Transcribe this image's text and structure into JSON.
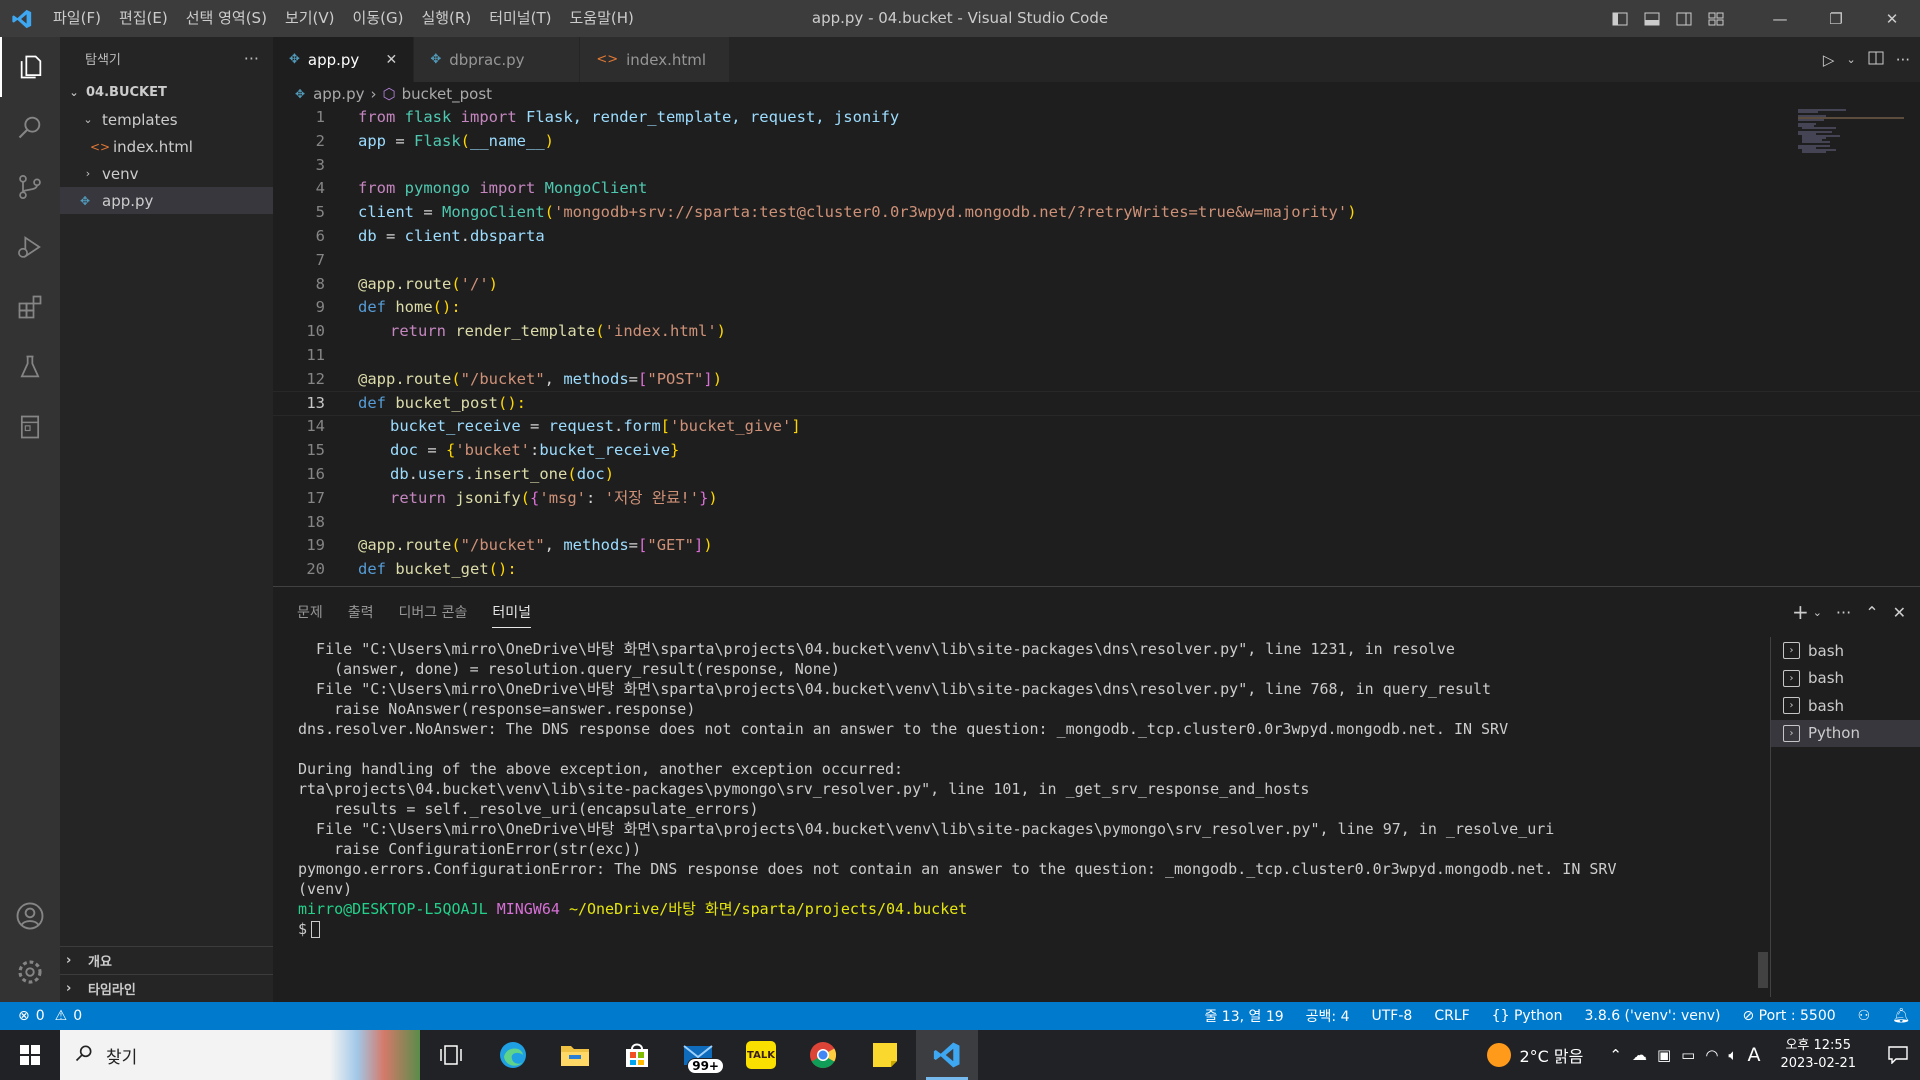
{
  "titlebar": {
    "menu": [
      "파일(F)",
      "편집(E)",
      "선택 영역(S)",
      "보기(V)",
      "이동(G)",
      "실행(R)",
      "터미널(T)",
      "도움말(H)"
    ],
    "title": "app.py - 04.bucket - Visual Studio Code",
    "window_controls": [
      "minimize-icon",
      "restore-icon",
      "close-icon"
    ]
  },
  "sidebar": {
    "header": "탐색기",
    "more": "···",
    "root": "04.BUCKET",
    "tree": [
      {
        "label": "templates",
        "type": "folder-open"
      },
      {
        "label": "index.html",
        "type": "html-file"
      },
      {
        "label": "venv",
        "type": "folder-closed"
      },
      {
        "label": "app.py",
        "type": "python-file",
        "selected": true
      }
    ],
    "outline": "개요",
    "timeline": "타임라인"
  },
  "tabs": [
    {
      "label": "app.py",
      "active": true,
      "close": "✕"
    },
    {
      "label": "dbprac.py",
      "active": false
    },
    {
      "label": "index.html",
      "active": false
    }
  ],
  "breadcrumb": {
    "file": "app.py",
    "separator": "›",
    "symbol": "bucket_post"
  },
  "editor": {
    "current_line": 13,
    "line_numbers": [
      "1",
      "2",
      "3",
      "4",
      "5",
      "6",
      "7",
      "8",
      "9",
      "10",
      "11",
      "12",
      "13",
      "14",
      "15",
      "16",
      "17",
      "18",
      "19",
      "20"
    ],
    "lines": {
      "l1": [
        "from",
        " flask ",
        "import",
        " Flask, render_template, request, jsonify"
      ],
      "l2": [
        "app",
        " = ",
        "Flask",
        "(",
        "__name__",
        ")"
      ],
      "l4": [
        "from",
        " pymongo ",
        "import",
        " MongoClient"
      ],
      "l5": [
        "client",
        " = ",
        "MongoClient",
        "(",
        "'mongodb+srv://sparta:test@cluster0.0r3wpyd.mongodb.net/?retryWrites=true&w=majority'",
        ")"
      ],
      "l6": [
        "db",
        " = ",
        "client",
        ".",
        "dbsparta"
      ],
      "l8": [
        "@app.route",
        "(",
        "'/'",
        ")"
      ],
      "l9": [
        "def",
        " ",
        "home",
        "():"
      ],
      "l10": [
        "return",
        " ",
        "render_template",
        "(",
        "'index.html'",
        ")"
      ],
      "l12": [
        "@app.route",
        "(",
        "\"/bucket\"",
        ", ",
        "methods",
        "=",
        "[",
        "\"POST\"",
        "]",
        ")"
      ],
      "l13": [
        "def",
        " ",
        "bucket_post",
        "():"
      ],
      "l14": [
        "bucket_receive",
        " = ",
        "request",
        ".",
        "form",
        "[",
        "'bucket_give'",
        "]"
      ],
      "l15": [
        "doc",
        " = ",
        "{",
        "'bucket'",
        ":",
        "bucket_receive",
        "}"
      ],
      "l16": [
        "db",
        ".",
        "users",
        ".",
        "insert_one",
        "(",
        "doc",
        ")"
      ],
      "l17": [
        "return",
        " ",
        "jsonify",
        "(",
        "{",
        "'msg'",
        ": ",
        "'저장 완료!'",
        "}",
        ")"
      ],
      "l19": [
        "@app.route",
        "(",
        "\"/bucket\"",
        ", ",
        "methods",
        "=",
        "[",
        "\"GET\"",
        "]",
        ")"
      ],
      "l20": [
        "def",
        " ",
        "bucket_get",
        "():"
      ]
    }
  },
  "panel": {
    "tabs": [
      "문제",
      "출력",
      "디버그 콘솔",
      "터미널"
    ],
    "active_tab": "터미널",
    "terminal_lines": [
      "  File \"C:\\Users\\mirro\\OneDrive\\바탕 화면\\sparta\\projects\\04.bucket\\venv\\lib\\site-packages\\dns\\resolver.py\", line 1231, in resolve",
      "    (answer, done) = resolution.query_result(response, None)",
      "  File \"C:\\Users\\mirro\\OneDrive\\바탕 화면\\sparta\\projects\\04.bucket\\venv\\lib\\site-packages\\dns\\resolver.py\", line 768, in query_result",
      "    raise NoAnswer(response=answer.response)",
      "dns.resolver.NoAnswer: The DNS response does not contain an answer to the question: _mongodb._tcp.cluster0.0r3wpyd.mongodb.net. IN SRV",
      "",
      "During handling of the above exception, another exception occurred:",
      "rta\\projects\\04.bucket\\venv\\lib\\site-packages\\pymongo\\srv_resolver.py\", line 101, in _get_srv_response_and_hosts",
      "    results = self._resolve_uri(encapsulate_errors)",
      "  File \"C:\\Users\\mirro\\OneDrive\\바탕 화면\\sparta\\projects\\04.bucket\\venv\\lib\\site-packages\\pymongo\\srv_resolver.py\", line 97, in _resolve_uri",
      "    raise ConfigurationError(str(exc))",
      "pymongo.errors.ConfigurationError: The DNS response does not contain an answer to the question: _mongodb._tcp.cluster0.0r3wpyd.mongodb.net. IN SRV",
      "(venv)"
    ],
    "prompt": {
      "user": "mirro@DESKTOP-L5QOAJL",
      "shell": "MINGW64",
      "path": "~/OneDrive/바탕 화면/sparta/projects/04.bucket",
      "symbol": "$"
    },
    "terminals": [
      "bash",
      "bash",
      "bash",
      "Python"
    ],
    "selected_terminal": 3
  },
  "statusbar": {
    "errors": "0",
    "warnings": "0",
    "position": "줄 13, 열 19",
    "spaces": "공백: 4",
    "encoding": "UTF-8",
    "eol": "CRLF",
    "language": "Python",
    "interpreter": "3.8.6 ('venv': venv)",
    "port": "Port : 5500"
  },
  "taskbar": {
    "search": "찾기",
    "mail_badge": "99+",
    "kakao": "TALK",
    "weather": "2°C  맑음",
    "ime": "A",
    "time": "오후 12:55",
    "date": "2023-02-21"
  },
  "colors": {
    "accent": "#007acc",
    "activity": "#333333",
    "sidebar": "#252526",
    "editor": "#1e1e1e"
  }
}
